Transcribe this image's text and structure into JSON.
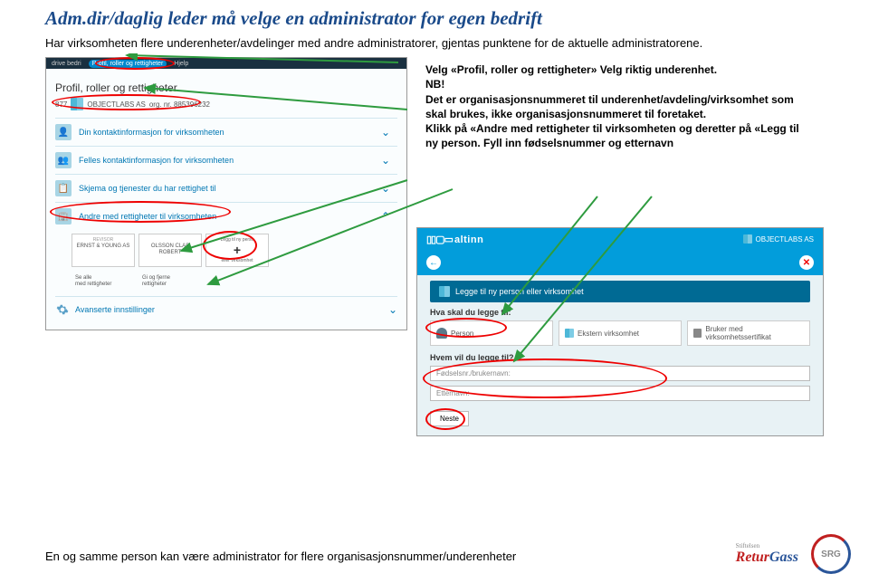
{
  "title": "Adm.dir/daglig leder må velge en administrator for egen bedrift",
  "subtitle": "Har virksomheten flere underenheter/avdelinger med andre administratorer, gjentas punktene for de aktuelle administratorene.",
  "left_screenshot": {
    "topbar": {
      "item1": "drive bedri",
      "item2": "Profil, roller og rettigheter",
      "item3": "Hjelp"
    },
    "heading": "Profil, roller og rettigheter",
    "org_prefix": "877",
    "org_name": "OBJECTLABS AS",
    "org_label": "org. nr. 885396232",
    "rows": {
      "r1": "Din kontaktinformasjon for virksomheten",
      "r2": "Felles kontaktinformasjon for virksomheten",
      "r3": "Skjema og tjenester du har rettighet til",
      "r4": "Andre med rettigheter til virksomheten"
    },
    "cards": {
      "c1_title": "REVISOR",
      "c1_body": "ERNST & YOUNG AS",
      "c2_body": "OLSSON CLAS ROBERT",
      "c3_top": "Legg til ny perso",
      "c3_plus": "+",
      "c3_bottom": "eller virksomhet",
      "sa_top": "Se alle",
      "sa_bot": "med rettigheter",
      "gf_top": "Gi og fjerne",
      "gf_bot": "rettigheter"
    },
    "advanced": "Avanserte innstillinger"
  },
  "instruction": {
    "l1": "Velg «Profil, roller og rettigheter» Velg riktig underenhet.",
    "l2": "NB!",
    "l3": "Det er organisasjonsnummeret til underenhet/avdeling/virksomhet som skal brukes, ikke organisasjonsnummeret til foretaket.",
    "l4": "Klikk på «Andre med rettigheter til virksomheten og deretter på «Legg til ny person.  Fyll inn fødselsnummer og etternavn"
  },
  "right_screenshot": {
    "logo": "altinn",
    "company": "OBJECTLABS AS",
    "heading": "Legge til ny person eller virksomhet",
    "q1": "Hva skal du legge til:",
    "opts": {
      "o1": "Person",
      "o2": "Ekstern virksomhet",
      "o3": "Bruker med virksomhetssertifikat"
    },
    "q2": "Hvem vil du legge til?",
    "inputs": {
      "i1": "Fødselsnr./brukernavn:",
      "i2": "Etternavn:"
    },
    "neste": "Neste"
  },
  "footer": "En og samme person kan være administrator for flere organisasjonsnummer/underenheter",
  "logos": {
    "stift": "Stiftelsen",
    "retur": "Retur",
    "gass": "Gass",
    "srg": "SRG"
  }
}
